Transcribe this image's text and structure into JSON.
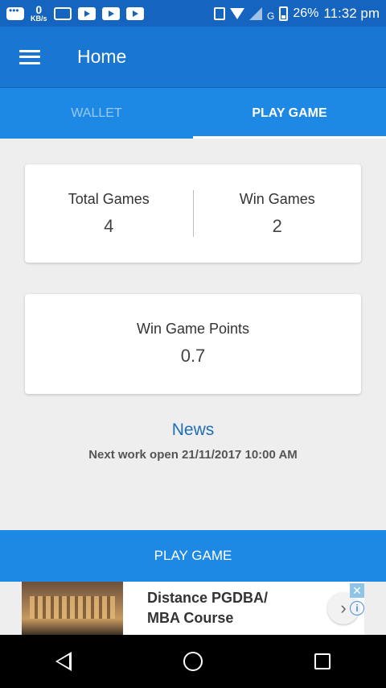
{
  "status_bar": {
    "network_speed_value": "0",
    "network_speed_unit": "KB/s",
    "network_type": "G",
    "battery": "26%",
    "time": "11:32 pm",
    "icons": [
      "message-icon",
      "image-icon",
      "youtube-icon",
      "youtube-icon",
      "youtube-icon",
      "vibrate-icon",
      "wifi-icon",
      "signal-icon",
      "battery-charging-icon"
    ]
  },
  "app_bar": {
    "title": "Home",
    "menu_icon": "hamburger-menu-icon"
  },
  "tabs": [
    {
      "label": "WALLET",
      "active": false
    },
    {
      "label": "PLAY GAME",
      "active": true
    }
  ],
  "stats": {
    "total_games_label": "Total Games",
    "total_games_value": "4",
    "win_games_label": "Win Games",
    "win_games_value": "2",
    "win_points_label": "Win Game Points",
    "win_points_value": "0.7"
  },
  "news": {
    "title": "News",
    "text": "Next work open 21/11/2017 10:00 AM"
  },
  "play_button": {
    "label": "PLAY GAME"
  },
  "ad": {
    "line1": "Distance PGDBA/",
    "line2": "MBA Course",
    "arrow_icon": "chevron-right-icon",
    "close_glyph": "✕",
    "info_glyph": "i"
  },
  "nav_bar": {
    "icons": [
      "back-icon",
      "home-icon",
      "recent-apps-icon"
    ]
  },
  "colors": {
    "status_bar": "#1565c0",
    "app_bar": "#1976d2",
    "accent": "#1e88e5",
    "news_title": "#1e6fb8",
    "background": "#eeeeee"
  }
}
